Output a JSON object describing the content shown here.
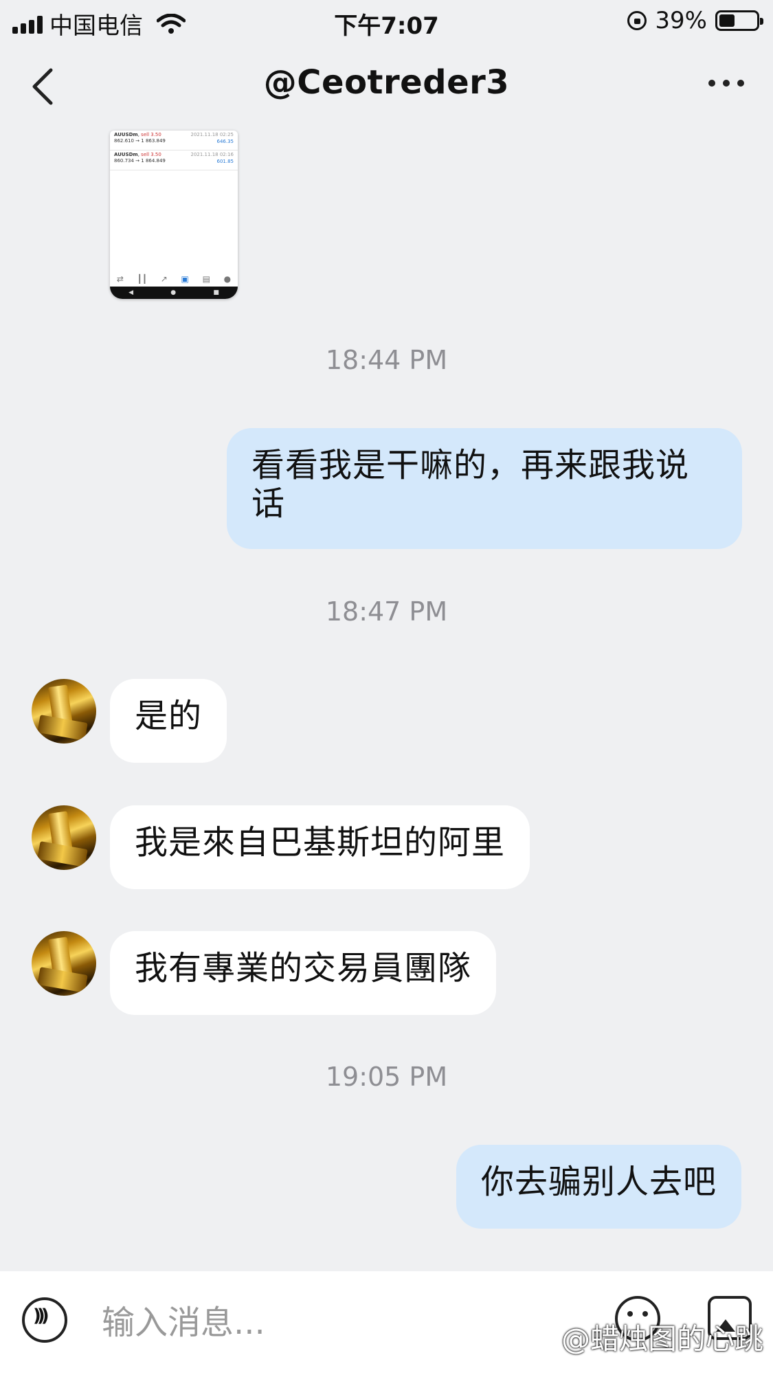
{
  "status_bar": {
    "carrier": "中国电信",
    "time": "下午7:07",
    "battery": "39%",
    "battery_level": 0.39,
    "icons": [
      "signal-icon",
      "wifi-icon",
      "orientation-lock-icon",
      "battery-icon"
    ]
  },
  "nav": {
    "title": "@Ceotreder3",
    "back_icon": "chevron-left-icon",
    "more_icon": "more-dots-icon"
  },
  "thumbnail": {
    "rows": [
      {
        "symbol": "AUUSDm",
        "action": "sell 3.50",
        "prices": "862.610 → 1 863.849",
        "time": "2021.11.18 02:25",
        "profit": "646.35"
      },
      {
        "symbol": "AUUSDm",
        "action": "sell 3.50",
        "prices": "860.734 → 1 864.849",
        "time": "2021.11.18 02:16",
        "profit": "601.85"
      }
    ]
  },
  "messages": {
    "t1": "18:44 PM",
    "m1": "看看我是干嘛的，再来跟我说话",
    "t2": "18:47 PM",
    "m2": "是的",
    "m3": "我是來自巴基斯坦的阿里",
    "m4": "我有專業的交易員團隊",
    "t3": "19:05 PM",
    "m5": "你去骗别人去吧"
  },
  "input_bar": {
    "placeholder": "输入消息...",
    "icons": [
      "voice-icon",
      "emoji-icon",
      "photo-icon"
    ]
  },
  "watermark": "@蜡烛图的心跳"
}
